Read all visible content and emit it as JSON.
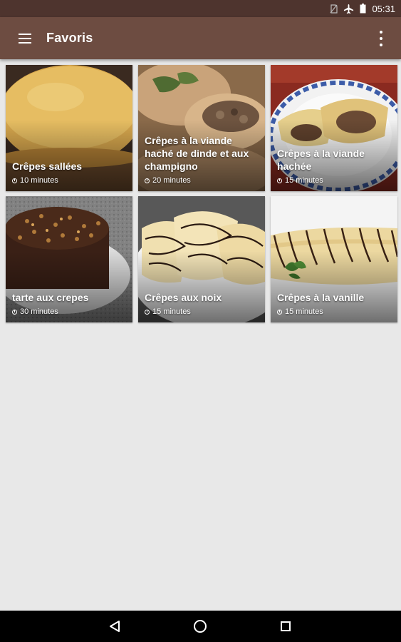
{
  "status_bar": {
    "time": "05:31",
    "icons": [
      "no-sim-icon",
      "airplane-mode-icon",
      "battery-icon"
    ]
  },
  "app_bar": {
    "title": "Favoris",
    "menu_icon": "hamburger-menu-icon",
    "overflow_icon": "more-vert-icon"
  },
  "recipes": [
    {
      "name": "Crêpes sallées",
      "time": "10 minutes",
      "image": "savory-crepes-stack-photo"
    },
    {
      "name": "Crêpes à la viande haché de dinde et aux champigno",
      "time": "20 minutes",
      "image": "turkey-mushroom-crepes-photo"
    },
    {
      "name": "Crêpes à la viande hachée",
      "time": "15 minutes",
      "image": "meat-filled-crepes-photo"
    },
    {
      "name": "tarte aux crepes",
      "time": "30 minutes",
      "image": "chocolate-crepe-cake-photo"
    },
    {
      "name": "Crêpes aux noix",
      "time": "15 minutes",
      "image": "nut-crepes-chocolate-drizzle-photo"
    },
    {
      "name": "Crêpes à la vanille",
      "time": "15 minutes",
      "image": "vanilla-crepes-chocolate-drizzle-photo"
    }
  ],
  "nav_bar": {
    "back_icon": "back-triangle-icon",
    "home_icon": "home-circle-icon",
    "recents_icon": "recents-square-icon"
  },
  "colors": {
    "status_bar": "#4e342e",
    "app_bar": "#6d4c41",
    "background": "#e8e8e8"
  }
}
